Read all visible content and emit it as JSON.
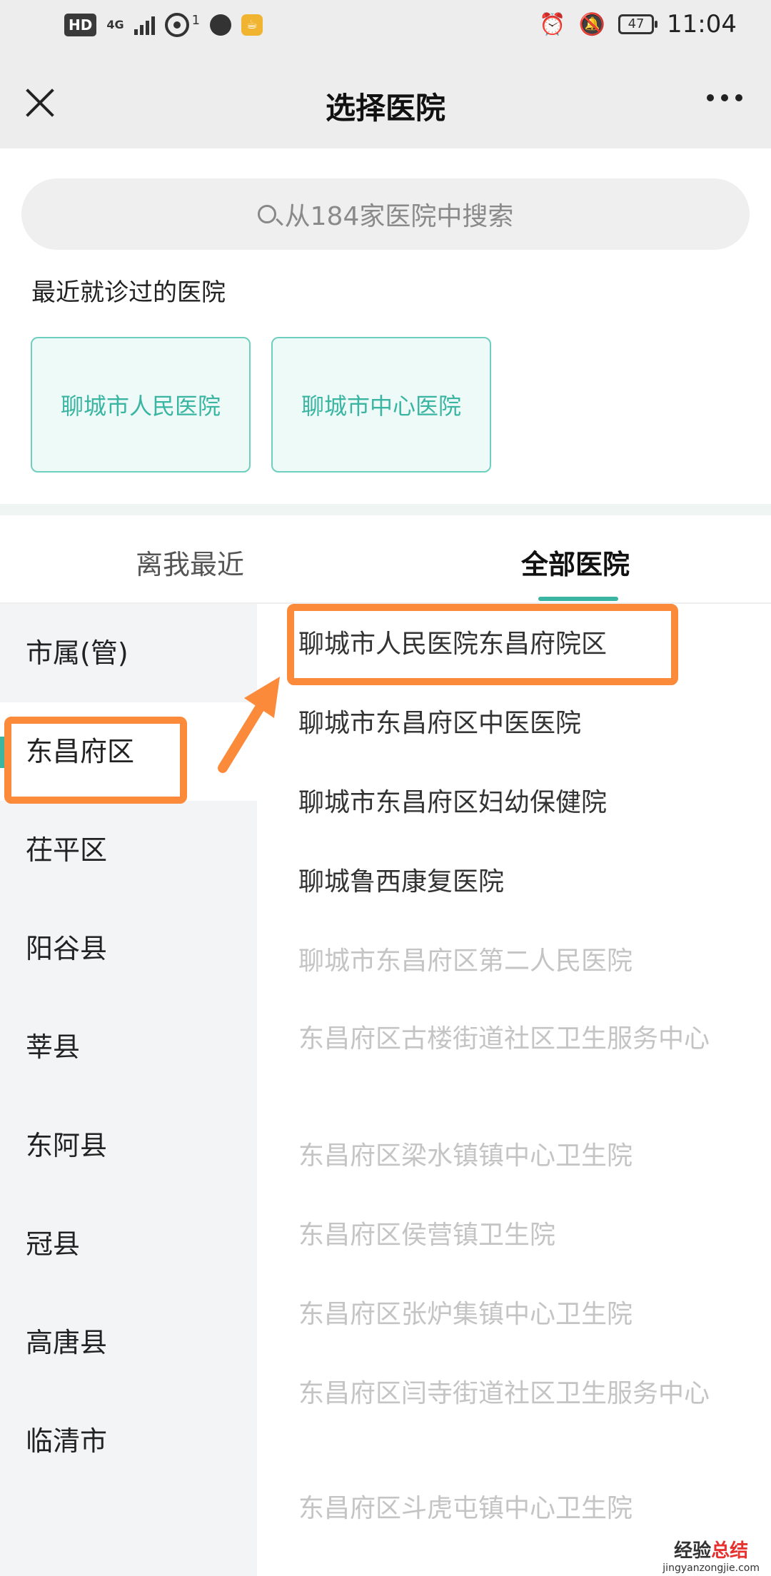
{
  "status_bar": {
    "hd": "HD",
    "signal": "4G",
    "hotspot_count": "1",
    "battery": "47",
    "time": "11:04"
  },
  "nav": {
    "title": "选择医院"
  },
  "search": {
    "placeholder": "从184家医院中搜索"
  },
  "recent": {
    "title": "最近就诊过的医院",
    "items": [
      "聊城市人民医院",
      "聊城市中心医院"
    ]
  },
  "tabs": {
    "nearby": "离我最近",
    "all": "全部医院"
  },
  "districts": [
    "市属(管)",
    "东昌府区",
    "茌平区",
    "阳谷县",
    "莘县",
    "东阿县",
    "冠县",
    "高唐县",
    "临清市"
  ],
  "hospitals": [
    "聊城市人民医院东昌府院区",
    "聊城市东昌府区中医医院",
    "聊城市东昌府区妇幼保健院",
    "聊城鲁西康复医院",
    "聊城市东昌府区第二人民医院",
    "东昌府区古楼街道社区卫生服务中心",
    "东昌府区梁水镇镇中心卫生院",
    "东昌府区侯营镇卫生院",
    "东昌府区张炉集镇中心卫生院",
    "东昌府区闫寺街道社区卫生服务中心",
    "东昌府区斗虎屯镇中心卫生院"
  ],
  "watermark": {
    "main_a": "经验",
    "main_b": "总结",
    "sub": "jingyanzongjie.com"
  },
  "colors": {
    "accent": "#3ab5a2",
    "annotation": "#fb8a3b"
  }
}
